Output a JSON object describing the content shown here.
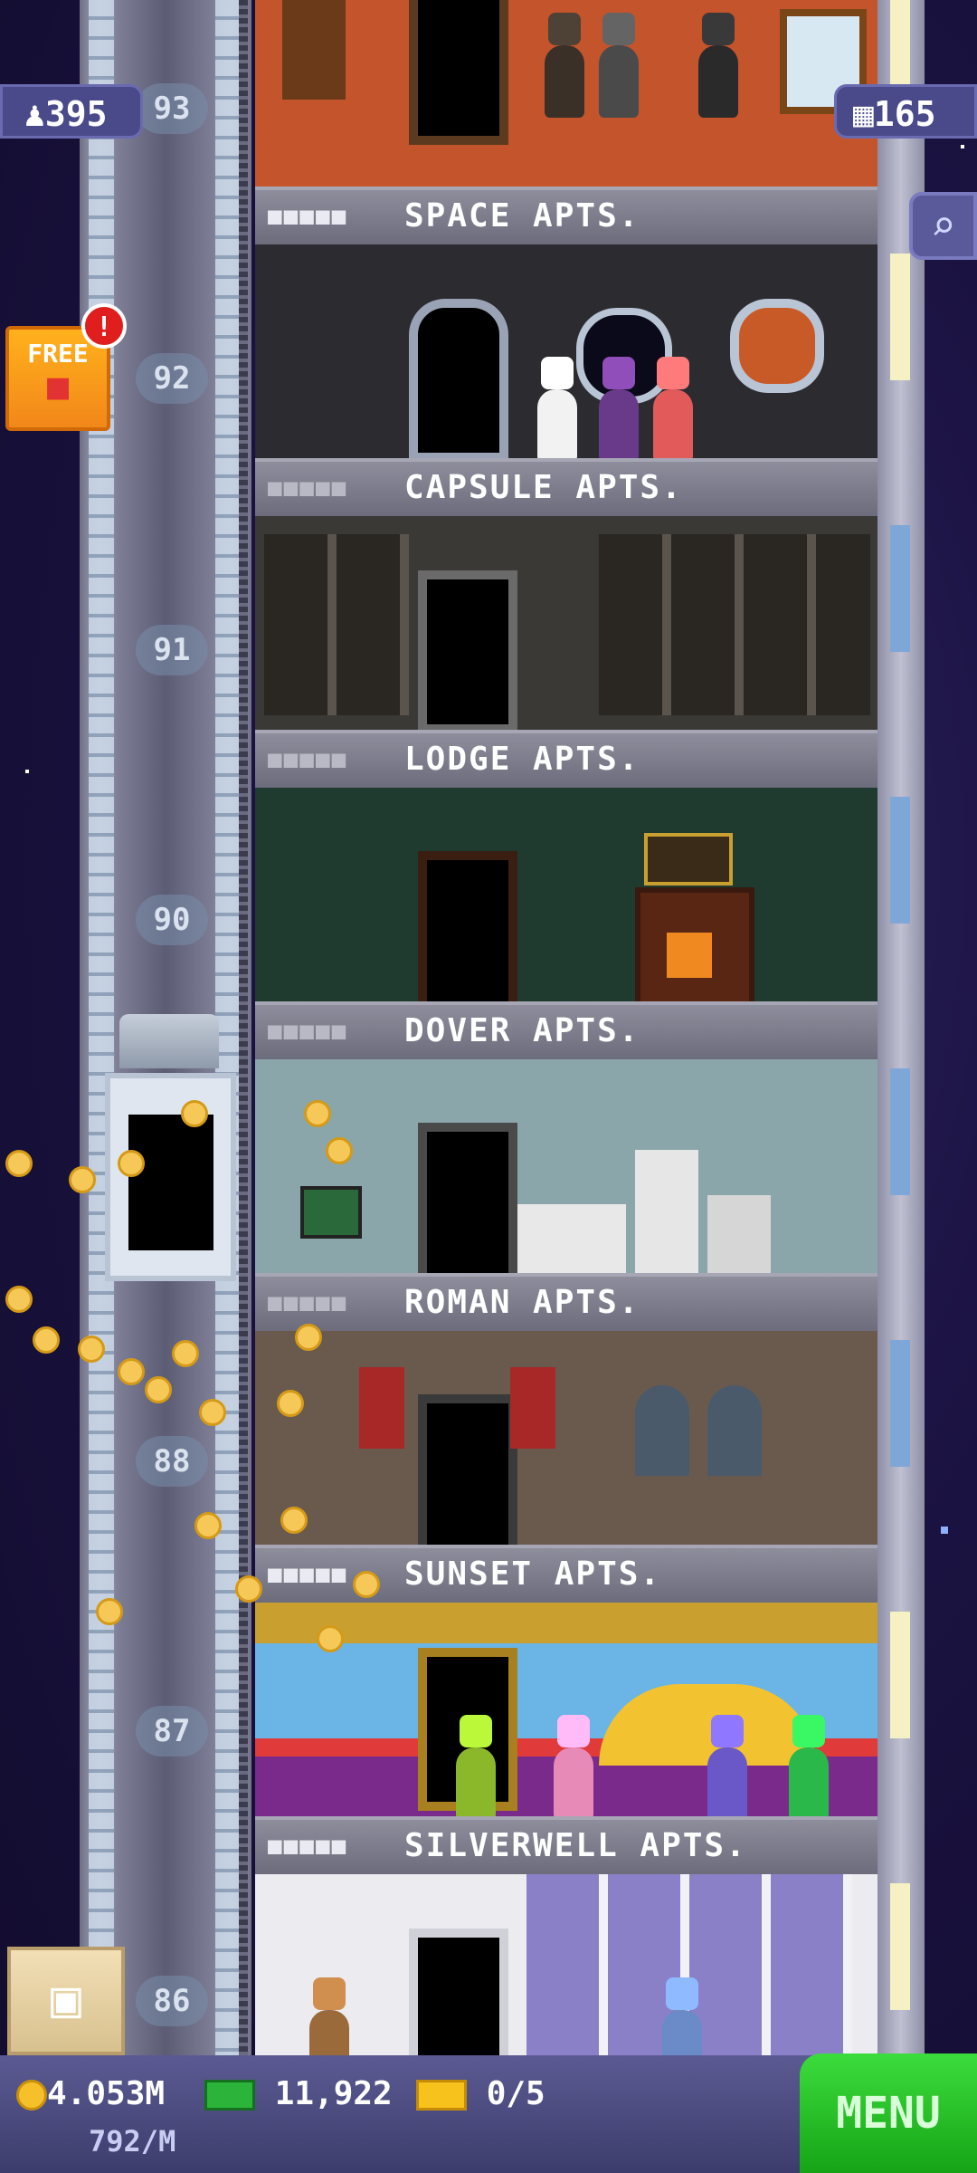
{
  "hud": {
    "population": "395",
    "bux": "165",
    "free_label": "FREE",
    "free_badge": "!"
  },
  "shaft": {
    "floor_numbers": [
      "93",
      "92",
      "91",
      "90",
      "88",
      "87",
      "86"
    ]
  },
  "floors": [
    {
      "name": "SPACE APTS."
    },
    {
      "name": "CAPSULE APTS."
    },
    {
      "name": "LODGE APTS."
    },
    {
      "name": "DOVER APTS."
    },
    {
      "name": "ROMAN APTS."
    },
    {
      "name": "SUNSET APTS."
    },
    {
      "name": "SILVERWELL APTS."
    }
  ],
  "bottom_bar": {
    "coins": "4.053M",
    "coin_rate": "792/M",
    "bux_total": "11,922",
    "tickets": "0/5",
    "menu_label": "MENU"
  },
  "colors": {
    "sky": "#1a1240",
    "hud_pill": "#4a4a8a",
    "menu_green": "#22b822",
    "free_orange": "#f2871a"
  },
  "icons": [
    "person-icon",
    "building-icon",
    "search-icon",
    "gift-icon",
    "coin-icon",
    "bux-icon",
    "ticket-icon",
    "crate-icon"
  ]
}
